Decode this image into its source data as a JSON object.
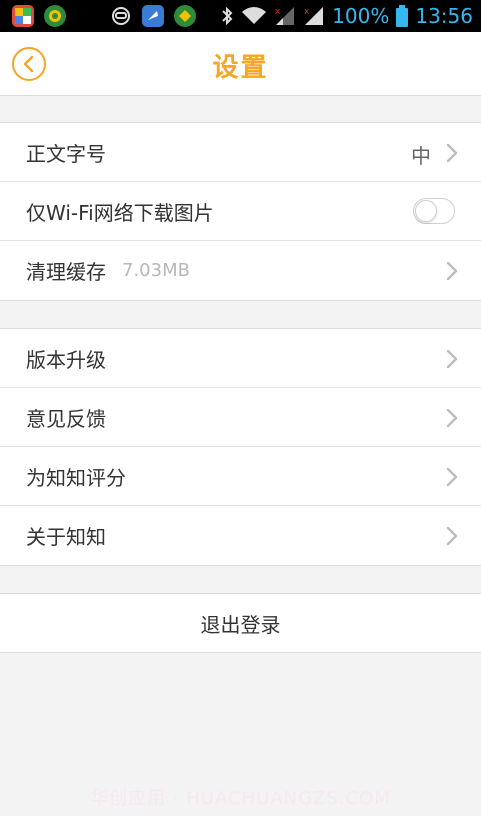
{
  "status_bar": {
    "battery": "100%",
    "time": "13:56"
  },
  "header": {
    "title": "设置"
  },
  "settings_group_1": {
    "font_size": {
      "label": "正文字号",
      "value": "中"
    },
    "wifi_only": {
      "label": "仅Wi-Fi网络下载图片",
      "enabled": false
    },
    "clear_cache": {
      "label": "清理缓存",
      "size": "7.03MB"
    }
  },
  "settings_group_2": {
    "items": [
      {
        "label": "版本升级"
      },
      {
        "label": "意见反馈"
      },
      {
        "label": "为知知评分"
      },
      {
        "label": "关于知知"
      }
    ]
  },
  "logout": {
    "label": "退出登录"
  },
  "watermark": "华创应用 · HUACHUANGZS.COM",
  "colors": {
    "accent": "#f5a623",
    "status_bar_text": "#35b7f0"
  }
}
